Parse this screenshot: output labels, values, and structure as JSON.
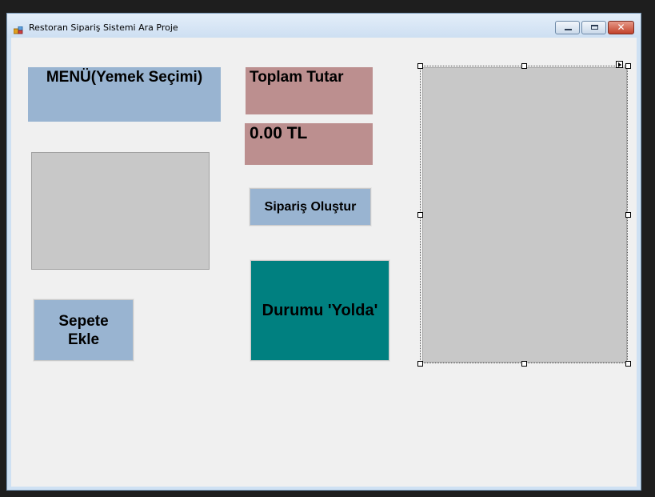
{
  "window": {
    "title": "Restoran Sipariş Sistemi Ara Proje",
    "minimize_icon": "minimize-icon",
    "maximize_icon": "maximize-icon",
    "close_icon": "close-icon",
    "close_glyph": "✕"
  },
  "labels": {
    "menu": "MENÜ(Yemek Seçimi)",
    "total_title": "Toplam Tutar",
    "total_value": "0.00 TL"
  },
  "buttons": {
    "create_order": "Sipariş Oluştur",
    "add_to_cart_line1": "Sepete",
    "add_to_cart_line2": "Ekle",
    "status": "Durumu 'Yolda'"
  },
  "colors": {
    "menu_label_bg": "#99b4d1",
    "total_bg": "#bc8f8f",
    "status_button_bg": "#008080",
    "list_bg": "#c8c8c8",
    "client_bg": "#f0f0f0"
  }
}
